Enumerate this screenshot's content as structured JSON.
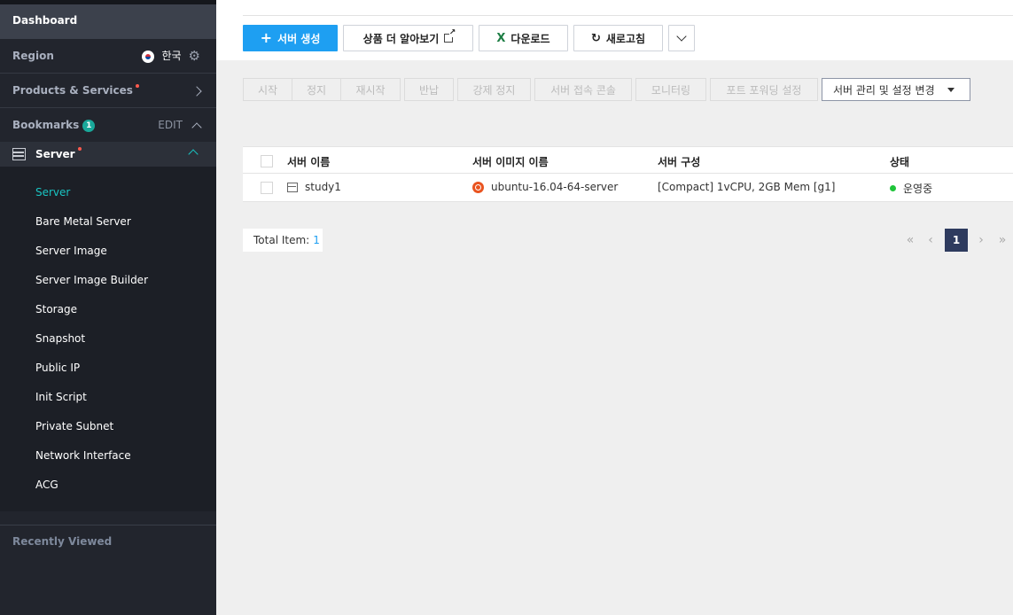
{
  "sidebar": {
    "dashboard": "Dashboard",
    "region_label": "Region",
    "region_value": "한국",
    "products_label": "Products & Services",
    "bookmarks_label": "Bookmarks",
    "bookmarks_count": "1",
    "edit_label": "EDIT",
    "server_label": "Server",
    "items": [
      {
        "label": "Server"
      },
      {
        "label": "Bare Metal Server"
      },
      {
        "label": "Server Image"
      },
      {
        "label": "Server Image Builder"
      },
      {
        "label": "Storage"
      },
      {
        "label": "Snapshot"
      },
      {
        "label": "Public IP"
      },
      {
        "label": "Init Script"
      },
      {
        "label": "Private Subnet"
      },
      {
        "label": "Network Interface"
      },
      {
        "label": "ACG"
      }
    ],
    "recently_viewed": "Recently Viewed"
  },
  "toolbar": {
    "create_label": "서버 생성",
    "learn_more_label": "상품 더 알아보기",
    "download_label": "다운로드",
    "refresh_label": "새로고침"
  },
  "actions": {
    "start": "시작",
    "stop": "정지",
    "restart": "재시작",
    "return": "반납",
    "force_stop": "강제 정지",
    "console": "서버 접속 콘솔",
    "monitoring": "모니터링",
    "port_forward": "포트 포워딩 설정",
    "manage": "서버 관리 및 설정 변경"
  },
  "table": {
    "headers": {
      "name": "서버 이름",
      "image": "서버 이미지 이름",
      "config": "서버 구성",
      "status": "상태"
    },
    "rows": [
      {
        "name": "study1",
        "image": "ubuntu-16.04-64-server",
        "config": "[Compact] 1vCPU, 2GB Mem [g1]",
        "status": "운영중"
      }
    ]
  },
  "footer": {
    "total_label": "Total Item:",
    "total_value": "1",
    "current_page": "1"
  },
  "colors": {
    "accent_teal": "#19c5c3",
    "primary_blue": "#1e9ff2",
    "status_green": "#1fc43a",
    "sidebar_bg": "#22252d",
    "page_active": "#2e3b5e"
  }
}
